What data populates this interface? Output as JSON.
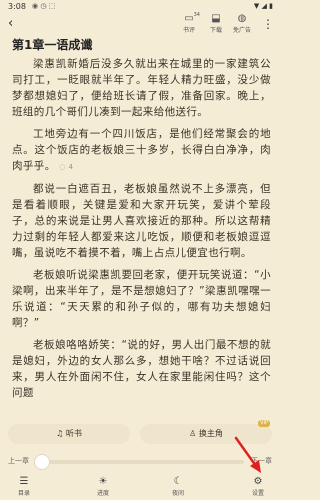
{
  "status": {
    "time": "3:08",
    "left_icons": "◉ ◷ ⬚",
    "right_icons": "▼ ◢ ▮"
  },
  "toolbar": {
    "back_icon": "chevron-left",
    "items": [
      {
        "label": "书评",
        "badge": "34",
        "icon": "comment-icon"
      },
      {
        "label": "下载",
        "icon": "download-icon"
      },
      {
        "label": "免广告",
        "icon": "no-ads-icon"
      }
    ],
    "more_icon": "more-vertical"
  },
  "chapter": {
    "title": "第1章一语成谶"
  },
  "paragraphs": [
    "梁惠凯新婚后没多久就出来在城里的一家建筑公司打工，一眨眼就半年了。年轻人精力旺盛，没少做梦都想媳妇了，便给班长请了假，准备回家。晚上，班组的几个哥们儿凑到一起来给他送行。",
    "工地旁边有一个四川饭店，是他们经常聚会的地点。这个饭店的老板娘三十多岁，长得白白净净，肉肉乎乎。",
    "都说一白遮百丑，老板娘虽然说不上多漂亮，但是看着顺眼，关键是爱和大家开玩笑，爱讲个荤段子，总的来说是让男人喜欢接近的那种。所以这帮精力过剩的年轻人都爱来这儿吃饭，顺便和老板娘逗逗嘴，虽说吃不着摸不着，嘴上占点儿便宜也行啊。",
    "老板娘听说梁惠凯要回老家，便开玩笑说道：“小梁啊，出来半年了，是不是想媳妇了？”梁惠凯嘿嘿一乐说道：“天天累的和孙子似的，哪有功夫想媳妇啊？”",
    "老板娘咯咯娇笑：“说的好，男人出门最不想的就是媳妇，外边的女人那么多，想她干啥？不过话说回来，男人在外面闲不住，女人在家里能闲住吗？这个问题"
  ],
  "inline_comment": "◌ 4",
  "actions": {
    "listen": "听书",
    "lead": "换主角",
    "vip": "VIP"
  },
  "progress": {
    "prev": "上一章",
    "next": "下一章",
    "value": 0.0
  },
  "nav": [
    {
      "label": "目录",
      "icon": "menu-icon"
    },
    {
      "label": "进度",
      "icon": "sun-icon"
    },
    {
      "label": "夜间",
      "icon": "moon-icon"
    },
    {
      "label": "设置",
      "icon": "gear-icon"
    }
  ],
  "colors": {
    "page_bg": "#f5ecd6",
    "button_bg": "#efe4cc",
    "arrow": "#e02020",
    "vip": "#e0b24a"
  }
}
